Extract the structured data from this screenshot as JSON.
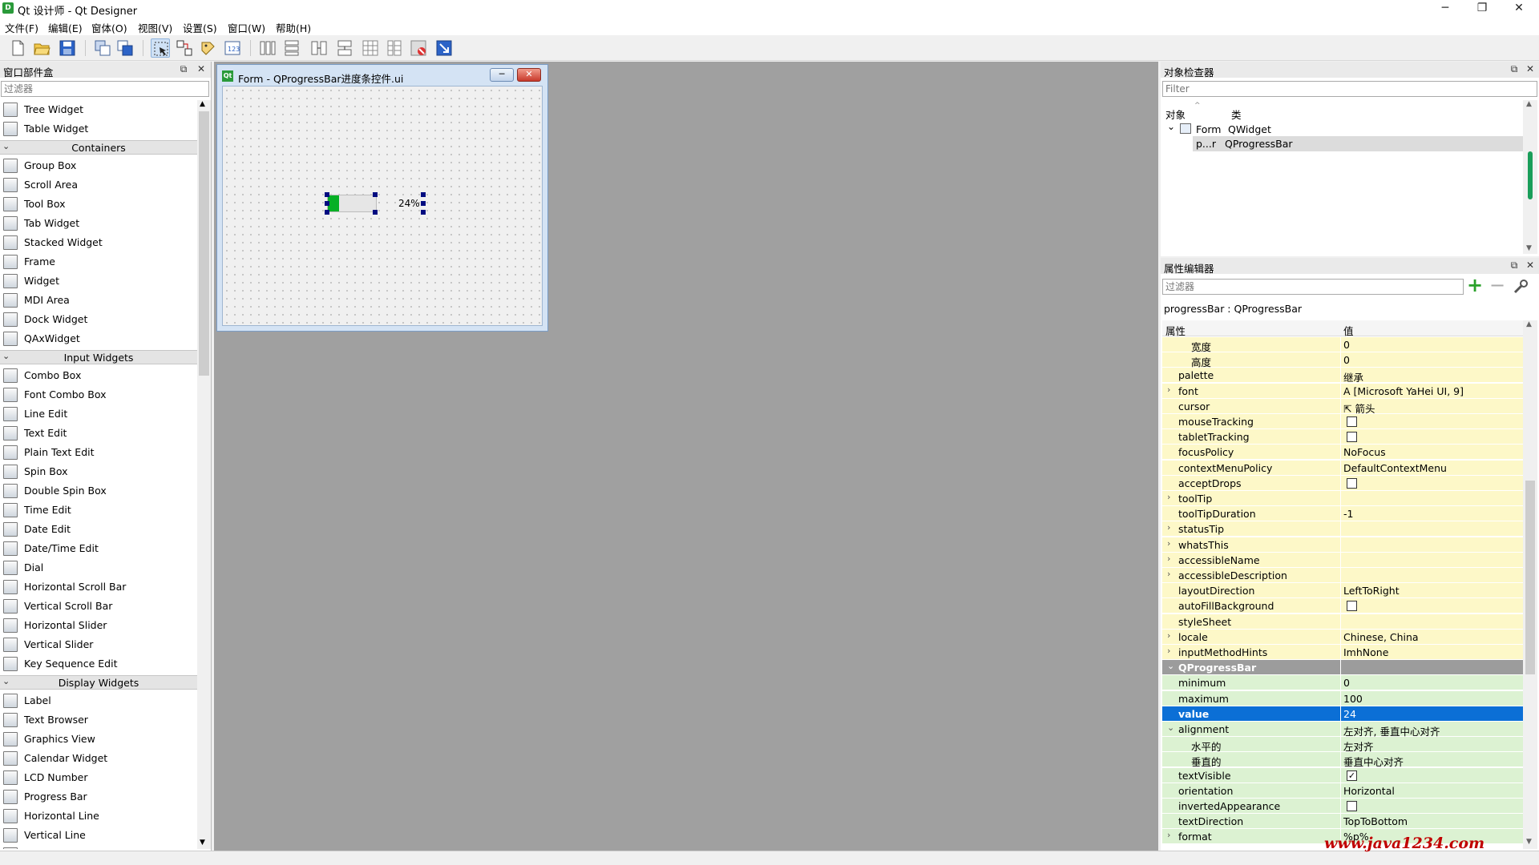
{
  "window": {
    "title": "Qt 设计师 - Qt Designer",
    "app_icon": "D",
    "minimize_icon": "─",
    "maximize_icon": "❐",
    "close_icon": "✕"
  },
  "menubar": [
    "文件(F)",
    "编辑(E)",
    "窗体(O)",
    "视图(V)",
    "设置(S)",
    "窗口(W)",
    "帮助(H)"
  ],
  "toolbar": {
    "icons": [
      "new-file-icon",
      "open-file-icon",
      "save-icon",
      "send-to-back-icon",
      "bring-to-front-icon",
      "edit-widgets-icon",
      "edit-signals-slots-icon",
      "edit-buddies-icon",
      "edit-tab-order-icon",
      "layout-horizontal-icon",
      "layout-vertical-icon",
      "layout-horizontal-splitter-icon",
      "layout-vertical-splitter-icon",
      "layout-grid-icon",
      "layout-form-icon",
      "break-layout-icon",
      "adjust-size-icon"
    ]
  },
  "widgetbox": {
    "title": "窗口部件盒",
    "float_icon": "⧉",
    "close_icon": "✕",
    "filter_placeholder": "过滤器",
    "items": [
      {
        "type": "item",
        "label": "Tree Widget",
        "icon": "tree-widget-icon"
      },
      {
        "type": "item",
        "label": "Table Widget",
        "icon": "table-widget-icon"
      },
      {
        "type": "category",
        "label": "Containers"
      },
      {
        "type": "item",
        "label": "Group Box",
        "icon": "group-box-icon"
      },
      {
        "type": "item",
        "label": "Scroll Area",
        "icon": "scroll-area-icon"
      },
      {
        "type": "item",
        "label": "Tool Box",
        "icon": "tool-box-icon"
      },
      {
        "type": "item",
        "label": "Tab Widget",
        "icon": "tab-widget-icon"
      },
      {
        "type": "item",
        "label": "Stacked Widget",
        "icon": "stacked-widget-icon"
      },
      {
        "type": "item",
        "label": "Frame",
        "icon": "frame-icon"
      },
      {
        "type": "item",
        "label": "Widget",
        "icon": "widget-icon"
      },
      {
        "type": "item",
        "label": "MDI Area",
        "icon": "mdi-area-icon"
      },
      {
        "type": "item",
        "label": "Dock Widget",
        "icon": "dock-widget-icon"
      },
      {
        "type": "item",
        "label": "QAxWidget",
        "icon": "qaxwidget-icon"
      },
      {
        "type": "category",
        "label": "Input Widgets"
      },
      {
        "type": "item",
        "label": "Combo Box",
        "icon": "combo-box-icon"
      },
      {
        "type": "item",
        "label": "Font Combo Box",
        "icon": "font-combo-box-icon"
      },
      {
        "type": "item",
        "label": "Line Edit",
        "icon": "line-edit-icon"
      },
      {
        "type": "item",
        "label": "Text Edit",
        "icon": "text-edit-icon"
      },
      {
        "type": "item",
        "label": "Plain Text Edit",
        "icon": "plain-text-edit-icon"
      },
      {
        "type": "item",
        "label": "Spin Box",
        "icon": "spin-box-icon"
      },
      {
        "type": "item",
        "label": "Double Spin Box",
        "icon": "double-spin-box-icon"
      },
      {
        "type": "item",
        "label": "Time Edit",
        "icon": "time-edit-icon"
      },
      {
        "type": "item",
        "label": "Date Edit",
        "icon": "date-edit-icon"
      },
      {
        "type": "item",
        "label": "Date/Time Edit",
        "icon": "date-time-edit-icon"
      },
      {
        "type": "item",
        "label": "Dial",
        "icon": "dial-icon"
      },
      {
        "type": "item",
        "label": "Horizontal Scroll Bar",
        "icon": "horizontal-scroll-bar-icon"
      },
      {
        "type": "item",
        "label": "Vertical Scroll Bar",
        "icon": "vertical-scroll-bar-icon"
      },
      {
        "type": "item",
        "label": "Horizontal Slider",
        "icon": "horizontal-slider-icon"
      },
      {
        "type": "item",
        "label": "Vertical Slider",
        "icon": "vertical-slider-icon"
      },
      {
        "type": "item",
        "label": "Key Sequence Edit",
        "icon": "key-sequence-edit-icon"
      },
      {
        "type": "category",
        "label": "Display Widgets"
      },
      {
        "type": "item",
        "label": "Label",
        "icon": "label-icon"
      },
      {
        "type": "item",
        "label": "Text Browser",
        "icon": "text-browser-icon"
      },
      {
        "type": "item",
        "label": "Graphics View",
        "icon": "graphics-view-icon"
      },
      {
        "type": "item",
        "label": "Calendar Widget",
        "icon": "calendar-widget-icon"
      },
      {
        "type": "item",
        "label": "LCD Number",
        "icon": "lcd-number-icon"
      },
      {
        "type": "item",
        "label": "Progress Bar",
        "icon": "progress-bar-icon"
      },
      {
        "type": "item",
        "label": "Horizontal Line",
        "icon": "horizontal-line-icon"
      },
      {
        "type": "item",
        "label": "Vertical Line",
        "icon": "vertical-line-icon"
      },
      {
        "type": "item",
        "label": "OpenGL Widget",
        "icon": "opengl-widget-icon"
      }
    ]
  },
  "form": {
    "title": "Form - QProgressBar进度条控件.ui",
    "icon": "Qt",
    "min_icon": "─",
    "close_icon": "✕",
    "progress_text": "24%",
    "progress_value": 24,
    "progress_color": "#06b025"
  },
  "object_inspector": {
    "title": "对象检查器",
    "float_icon": "⧉",
    "close_icon": "✕",
    "filter_placeholder": "Filter",
    "col_object": "对象",
    "col_class": "类",
    "tree": [
      {
        "object": "Form",
        "class": "QWidget",
        "expander": "⌄"
      },
      {
        "object": "p...r",
        "class": "QProgressBar"
      }
    ]
  },
  "property_editor": {
    "title": "属性编辑器",
    "float_icon": "⧉",
    "close_icon": "✕",
    "filter_placeholder": "过滤器",
    "add_icon": "+",
    "remove_icon": "−",
    "config_icon": "wrench-icon",
    "class_label": "progressBar : QProgressBar",
    "col_property": "属性",
    "col_value": "值",
    "accent_selected": "#0b6fd6",
    "rows": [
      {
        "name": "宽度",
        "value": "0",
        "indent": 2,
        "kind": "widget"
      },
      {
        "name": "高度",
        "value": "0",
        "indent": 2,
        "kind": "widget"
      },
      {
        "name": "palette",
        "value": "继承",
        "indent": 1,
        "kind": "widget"
      },
      {
        "name": "font",
        "value": "A  [Microsoft YaHei UI, 9]",
        "indent": 1,
        "kind": "widget",
        "expander": "›"
      },
      {
        "name": "cursor",
        "value": "⇱  箭头",
        "indent": 1,
        "kind": "widget"
      },
      {
        "name": "mouseTracking",
        "value": "",
        "indent": 1,
        "kind": "widget",
        "checkbox": "unchecked"
      },
      {
        "name": "tabletTracking",
        "value": "",
        "indent": 1,
        "kind": "widget",
        "checkbox": "unchecked"
      },
      {
        "name": "focusPolicy",
        "value": "NoFocus",
        "indent": 1,
        "kind": "widget"
      },
      {
        "name": "contextMenuPolicy",
        "value": "DefaultContextMenu",
        "indent": 1,
        "kind": "widget"
      },
      {
        "name": "acceptDrops",
        "value": "",
        "indent": 1,
        "kind": "widget",
        "checkbox": "unchecked"
      },
      {
        "name": "toolTip",
        "value": "",
        "indent": 1,
        "kind": "widget",
        "expander": "›"
      },
      {
        "name": "toolTipDuration",
        "value": "-1",
        "indent": 1,
        "kind": "widget"
      },
      {
        "name": "statusTip",
        "value": "",
        "indent": 1,
        "kind": "widget",
        "expander": "›"
      },
      {
        "name": "whatsThis",
        "value": "",
        "indent": 1,
        "kind": "widget",
        "expander": "›"
      },
      {
        "name": "accessibleName",
        "value": "",
        "indent": 1,
        "kind": "widget",
        "expander": "›"
      },
      {
        "name": "accessibleDescription",
        "value": "",
        "indent": 1,
        "kind": "widget",
        "expander": "›"
      },
      {
        "name": "layoutDirection",
        "value": "LeftToRight",
        "indent": 1,
        "kind": "widget"
      },
      {
        "name": "autoFillBackground",
        "value": "",
        "indent": 1,
        "kind": "widget",
        "checkbox": "unchecked"
      },
      {
        "name": "styleSheet",
        "value": "",
        "indent": 1,
        "kind": "widget"
      },
      {
        "name": "locale",
        "value": "Chinese, China",
        "indent": 1,
        "kind": "widget",
        "expander": "›"
      },
      {
        "name": "inputMethodHints",
        "value": "ImhNone",
        "indent": 1,
        "kind": "widget",
        "expander": "›"
      },
      {
        "name": "QProgressBar",
        "value": "",
        "indent": 1,
        "kind": "section",
        "expander": "⌄"
      },
      {
        "name": "minimum",
        "value": "0",
        "indent": 1,
        "kind": "pb"
      },
      {
        "name": "maximum",
        "value": "100",
        "indent": 1,
        "kind": "pb"
      },
      {
        "name": "value",
        "value": "24",
        "indent": 1,
        "kind": "selected"
      },
      {
        "name": "alignment",
        "value": "左对齐, 垂直中心对齐",
        "indent": 1,
        "kind": "pb",
        "expander": "⌄"
      },
      {
        "name": "水平的",
        "value": "左对齐",
        "indent": 2,
        "kind": "pb"
      },
      {
        "name": "垂直的",
        "value": "垂直中心对齐",
        "indent": 2,
        "kind": "pb"
      },
      {
        "name": "textVisible",
        "value": "",
        "indent": 1,
        "kind": "pb",
        "checkbox": "checked"
      },
      {
        "name": "orientation",
        "value": "Horizontal",
        "indent": 1,
        "kind": "pb"
      },
      {
        "name": "invertedAppearance",
        "value": "",
        "indent": 1,
        "kind": "pb",
        "checkbox": "unchecked"
      },
      {
        "name": "textDirection",
        "value": "TopToBottom",
        "indent": 1,
        "kind": "pb"
      },
      {
        "name": "format",
        "value": "%p%",
        "indent": 1,
        "kind": "pb",
        "expander": "›"
      }
    ],
    "colors": {
      "widget": "#fdf8c8",
      "pb": "#dcf2d2",
      "section": "#9c9c9c",
      "selected": "#0b6fd6"
    }
  },
  "watermark": "www.java1234.com"
}
